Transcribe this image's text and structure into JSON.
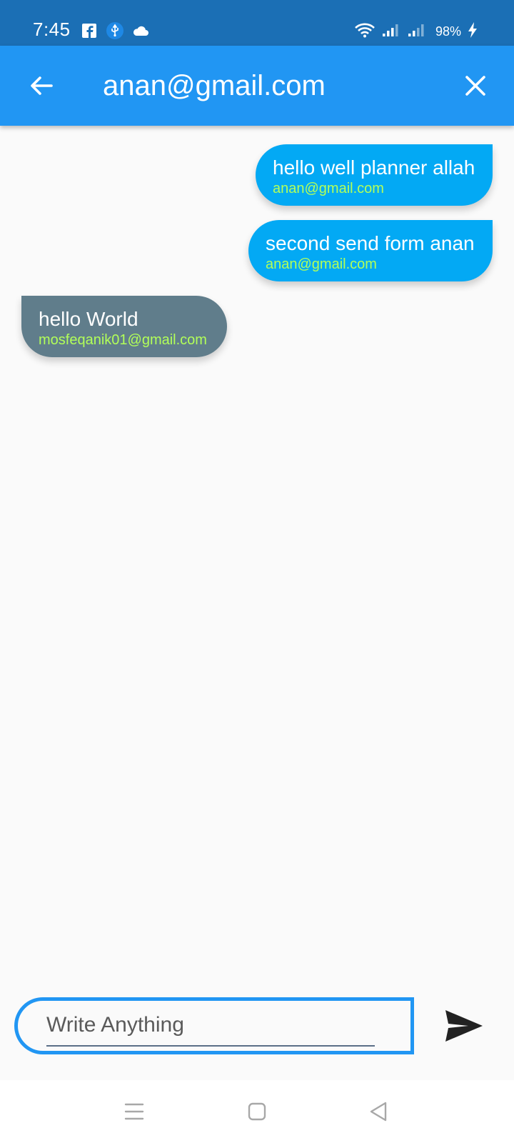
{
  "status_bar": {
    "time": "7:45",
    "left_icons": [
      "facebook-icon",
      "usb-icon",
      "cloud-icon"
    ],
    "right_icons": [
      "wifi-icon",
      "signal-icon",
      "signal-icon",
      "battery-charging-icon"
    ],
    "battery": "98%"
  },
  "app_bar": {
    "title": "anan@gmail.com",
    "back_icon": "arrow-left-icon",
    "close_icon": "close-icon",
    "color": "#2196F3"
  },
  "messages": [
    {
      "text": "hello well planner allah",
      "sender": "anan@gmail.com",
      "direction": "sent",
      "color": "#03A9F4"
    },
    {
      "text": "second send form anan",
      "sender": "anan@gmail.com",
      "direction": "sent",
      "color": "#03A9F4"
    },
    {
      "text": "hello World",
      "sender": "mosfeqanik01@gmail.com",
      "direction": "received",
      "color": "#607D8B"
    }
  ],
  "composer": {
    "placeholder": "Write Anything",
    "value": "",
    "send_icon": "send-icon"
  },
  "nav_bar": {
    "icons": [
      "menu-icon",
      "home-square-icon",
      "back-triangle-icon"
    ]
  }
}
